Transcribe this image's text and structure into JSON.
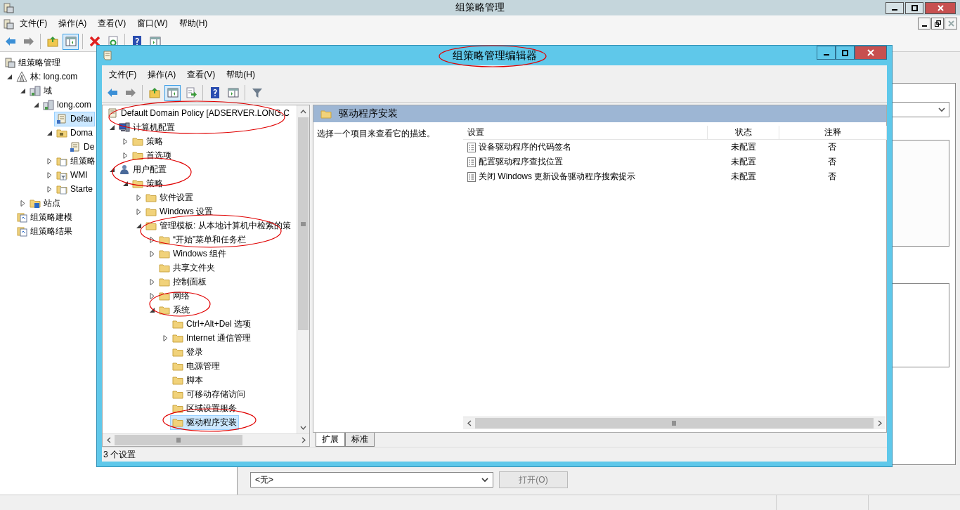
{
  "window": {
    "title": "组策略管理"
  },
  "menu": [
    "文件(F)",
    "操作(A)",
    "查看(V)",
    "窗口(W)",
    "帮助(H)"
  ],
  "toolbar": [
    {
      "kind": "back",
      "pressed": false
    },
    {
      "kind": "forward",
      "pressed": false
    },
    {
      "kind": "up",
      "pressed": false
    },
    {
      "kind": "tree",
      "pressed": true
    },
    {
      "kind": "delete",
      "pressed": false
    },
    {
      "kind": "refresh",
      "pressed": false
    },
    {
      "kind": "help",
      "pressed": false
    },
    {
      "kind": "pane",
      "pressed": false
    }
  ],
  "tree": [
    {
      "label": "组策略管理",
      "kind": "console",
      "selected": false,
      "children": [
        {
          "label": "林: long.com",
          "kind": "forest",
          "expanded": true,
          "selected": false,
          "children": [
            {
              "label": "域",
              "kind": "domains",
              "expanded": true,
              "selected": false,
              "children": [
                {
                  "label": "long.com",
                  "kind": "domain",
                  "expanded": true,
                  "selected": false,
                  "children": [
                    {
                      "label": "Defau",
                      "kind": "gpo",
                      "selected": true
                    },
                    {
                      "label": "Doma",
                      "kind": "ou",
                      "expanded": true,
                      "selected": false,
                      "children": [
                        {
                          "label": "De",
                          "kind": "gpo",
                          "selected": false
                        }
                      ]
                    },
                    {
                      "label": "组策略",
                      "kind": "container",
                      "expanded": false,
                      "selected": false
                    },
                    {
                      "label": "WMI",
                      "kind": "filter",
                      "expanded": false,
                      "selected": false
                    },
                    {
                      "label": "Starte",
                      "kind": "starter",
                      "expanded": false,
                      "selected": false
                    }
                  ]
                }
              ]
            },
            {
              "label": "站点",
              "kind": "site",
              "expanded": false,
              "selected": false
            }
          ]
        },
        {
          "label": "组策略建模",
          "kind": "modeling",
          "selected": false
        },
        {
          "label": "组策略结果",
          "kind": "results",
          "selected": false
        }
      ]
    }
  ],
  "bottom": {
    "dropdown": "<无>",
    "button": {
      "label": "打开(O)",
      "disabled": true
    }
  },
  "editor": {
    "title": "组策略管理编辑器",
    "menu": [
      "文件(F)",
      "操作(A)",
      "查看(V)",
      "帮助(H)"
    ],
    "toolbar": [
      {
        "kind": "back",
        "pressed": false
      },
      {
        "kind": "forward",
        "pressed": false
      },
      {
        "kind": "up",
        "pressed": false
      },
      {
        "kind": "tree",
        "pressed": true
      },
      {
        "kind": "export",
        "pressed": false
      },
      {
        "kind": "help",
        "pressed": false
      },
      {
        "kind": "pane",
        "pressed": false
      },
      {
        "kind": "filter",
        "pressed": false
      }
    ],
    "tree": [
      {
        "label": "Default Domain Policy [ADSERVER.LONG.C",
        "kind": "policy",
        "selected": false,
        "children": [
          {
            "label": "计算机配置",
            "kind": "computer",
            "expanded": true,
            "selected": false,
            "children": [
              {
                "label": "策略",
                "kind": "folder",
                "expanded": false,
                "selected": false
              },
              {
                "label": "首选项",
                "kind": "folder",
                "expanded": false,
                "selected": false
              }
            ]
          },
          {
            "label": "用户配置",
            "kind": "user",
            "expanded": true,
            "selected": false,
            "children": [
              {
                "label": "策略",
                "kind": "folder",
                "expanded": true,
                "selected": false,
                "children": [
                  {
                    "label": "软件设置",
                    "kind": "folder",
                    "expanded": false,
                    "selected": false
                  },
                  {
                    "label": "Windows 设置",
                    "kind": "folder",
                    "expanded": false,
                    "selected": false
                  },
                  {
                    "label": "管理模板: 从本地计算机中检索的策",
                    "kind": "folder",
                    "expanded": true,
                    "selected": false,
                    "children": [
                      {
                        "label": "“开始”菜单和任务栏",
                        "kind": "folder",
                        "expanded": false,
                        "selected": false
                      },
                      {
                        "label": "Windows 组件",
                        "kind": "folder",
                        "expanded": false,
                        "selected": false
                      },
                      {
                        "label": "共享文件夹",
                        "kind": "folder",
                        "selected": false
                      },
                      {
                        "label": "控制面板",
                        "kind": "folder",
                        "expanded": false,
                        "selected": false
                      },
                      {
                        "label": "网络",
                        "kind": "folder",
                        "expanded": false,
                        "selected": false
                      },
                      {
                        "label": "系统",
                        "kind": "folder",
                        "expanded": true,
                        "selected": false,
                        "children": [
                          {
                            "label": "Ctrl+Alt+Del 选项",
                            "kind": "folder",
                            "selected": false
                          },
                          {
                            "label": "Internet 通信管理",
                            "kind": "folder",
                            "expanded": false,
                            "selected": false
                          },
                          {
                            "label": "登录",
                            "kind": "folder",
                            "selected": false
                          },
                          {
                            "label": "电源管理",
                            "kind": "folder",
                            "selected": false
                          },
                          {
                            "label": "脚本",
                            "kind": "folder",
                            "selected": false
                          },
                          {
                            "label": "可移动存储访问",
                            "kind": "folder",
                            "selected": false
                          },
                          {
                            "label": "区域设置服务",
                            "kind": "folder",
                            "selected": false
                          },
                          {
                            "label": "驱动程序安装",
                            "kind": "folder",
                            "selected": true
                          }
                        ]
                      }
                    ]
                  }
                ]
              }
            ]
          }
        ]
      }
    ],
    "pane_title": "驱动程序安装",
    "description": "选择一个项目来查看它的描述。",
    "columns": [
      "设置",
      "状态",
      "注释"
    ],
    "rows": [
      {
        "setting": "设备驱动程序的代码签名",
        "state": "未配置",
        "comment": "否"
      },
      {
        "setting": "配置驱动程序查找位置",
        "state": "未配置",
        "comment": "否"
      },
      {
        "setting": "关闭 Windows 更新设备驱动程序搜索提示",
        "state": "未配置",
        "comment": "否"
      }
    ],
    "tabs": [
      {
        "label": "扩展",
        "selected": true
      },
      {
        "label": "标准",
        "selected": false
      }
    ],
    "status_bar": "3 个设置"
  }
}
